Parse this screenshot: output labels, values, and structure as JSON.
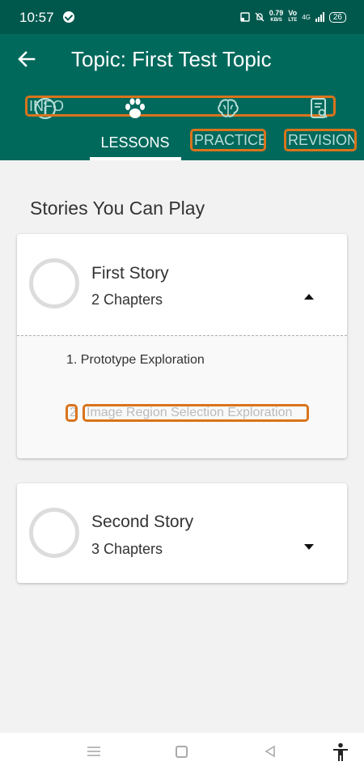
{
  "status_bar": {
    "time": "10:57",
    "speed": "0.79",
    "speed_unit": "KB/S",
    "network_1": "Vo",
    "network_1_sub": "LTE",
    "network_2": "4G",
    "battery": "26"
  },
  "app_bar": {
    "title": "Topic: First Test Topic",
    "tabs": [
      {
        "label": "INFO",
        "icon": "info-icon"
      },
      {
        "label": "LESSONS",
        "icon": "paw-icon"
      },
      {
        "label": "PRACTICE",
        "icon": "brain-icon"
      },
      {
        "label": "REVISION",
        "icon": "revision-icon"
      }
    ],
    "selected_tab": "LESSONS"
  },
  "main": {
    "section_title": "Stories You Can Play",
    "stories": [
      {
        "name": "First Story",
        "chapters_label": "2 Chapters",
        "expanded": true,
        "chapters": [
          {
            "title": "1. Prototype Exploration"
          },
          {
            "number": "2",
            "title": "Image Region Selection Exploration"
          }
        ]
      },
      {
        "name": "Second Story",
        "chapters_label": "3 Chapters",
        "expanded": false
      }
    ]
  },
  "colors": {
    "status_bar": "#00584d",
    "app_bar": "#00695c",
    "highlight": "#d9741c"
  }
}
